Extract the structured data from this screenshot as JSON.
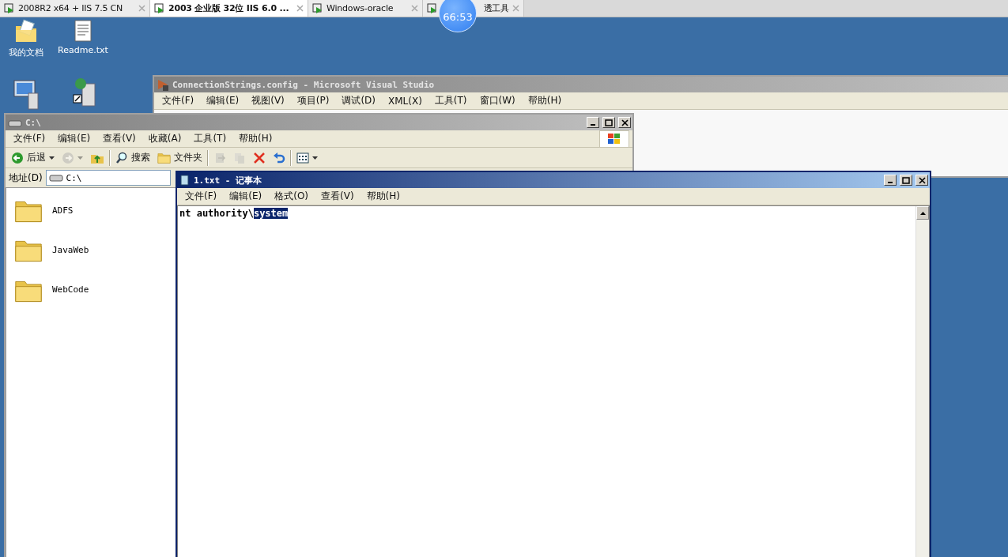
{
  "vm_tabs": [
    {
      "label": "2008R2 x64 + IIS 7.5 CN",
      "selected": false
    },
    {
      "label": "2003 企业版 32位 IIS 6.0 ...",
      "selected": true
    },
    {
      "label": "Windows-oracle",
      "selected": false
    },
    {
      "label": "透工具",
      "selected": false
    }
  ],
  "timer": "66:53",
  "desktop_icons": [
    {
      "kind": "documents",
      "label": "我的文档"
    },
    {
      "kind": "text-file",
      "label": "Readme.txt"
    }
  ],
  "vs_window": {
    "title": "ConnectionStrings.config - Microsoft Visual Studio",
    "active": false,
    "menu": [
      "文件(F)",
      "编辑(E)",
      "视图(V)",
      "项目(P)",
      "调试(D)",
      "XML(X)",
      "工具(T)",
      "窗口(W)",
      "帮助(H)"
    ]
  },
  "explorer": {
    "title": "C:\\",
    "active": false,
    "menu": [
      "文件(F)",
      "编辑(E)",
      "查看(V)",
      "收藏(A)",
      "工具(T)",
      "帮助(H)"
    ],
    "toolbar": [
      {
        "kind": "back",
        "label": "后退",
        "disabled": false
      },
      {
        "kind": "forward",
        "disabled": true
      },
      {
        "kind": "up",
        "disabled": false
      },
      {
        "kind": "separator"
      },
      {
        "kind": "search",
        "label": "搜索",
        "disabled": false
      },
      {
        "kind": "folders",
        "label": "文件夹",
        "disabled": false
      },
      {
        "kind": "separator"
      },
      {
        "kind": "move",
        "disabled": true
      },
      {
        "kind": "copy",
        "disabled": true
      },
      {
        "kind": "delete",
        "disabled": false
      },
      {
        "kind": "undo",
        "disabled": false
      },
      {
        "kind": "separator"
      },
      {
        "kind": "views",
        "disabled": false
      }
    ],
    "address_label": "地址(D)",
    "address": "C:\\",
    "folders": [
      {
        "name": "ADFS"
      },
      {
        "name": "JavaWeb"
      },
      {
        "name": "WebCode"
      }
    ]
  },
  "notepad": {
    "title": "1.txt - 记事本",
    "active": true,
    "menu": [
      "文件(F)",
      "编辑(E)",
      "格式(O)",
      "查看(V)",
      "帮助(H)"
    ],
    "text": "nt authority\\",
    "selection": "system"
  }
}
